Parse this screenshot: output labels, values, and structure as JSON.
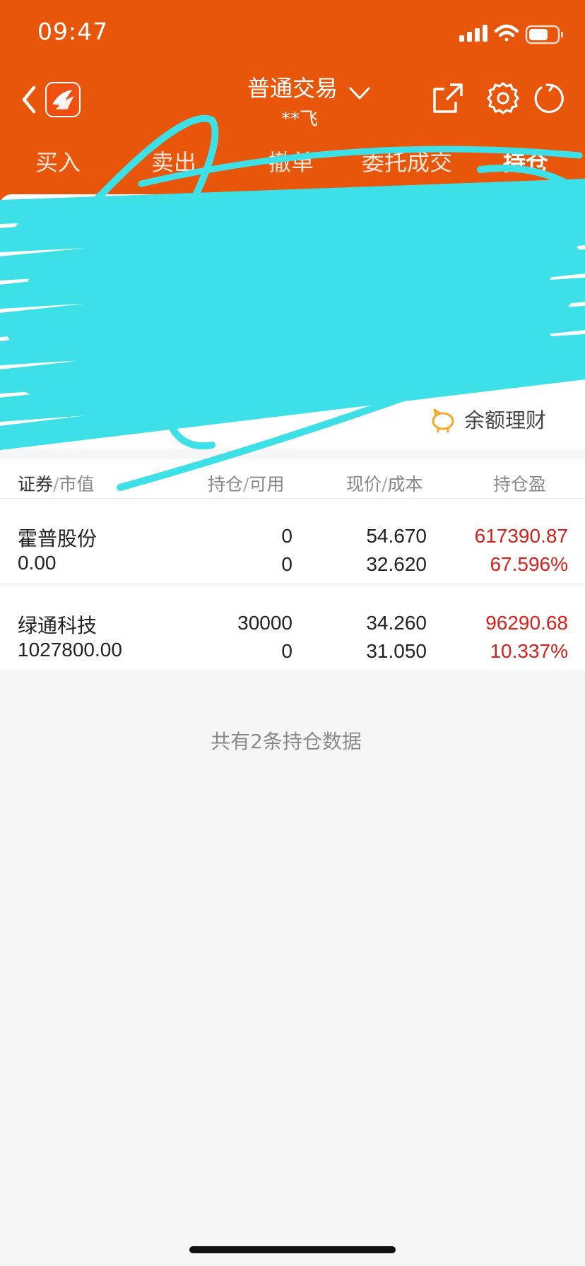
{
  "status_bar": {
    "time": "09:47"
  },
  "nav": {
    "title": "普通交易",
    "subtitle": "**飞",
    "icons": [
      "back-arrow-icon",
      "app-logo-icon",
      "chevron-down-icon",
      "share-icon",
      "gear-icon",
      "refresh-icon"
    ]
  },
  "tabs": [
    {
      "label": "买入",
      "active": false
    },
    {
      "label": "卖出",
      "active": false
    },
    {
      "label": "撤单",
      "active": false
    },
    {
      "label": "委托成交",
      "active": false
    },
    {
      "label": "持仓",
      "active": true
    }
  ],
  "shortcuts": {
    "balance_finance": "余额理财"
  },
  "table": {
    "headers": {
      "security": "证券",
      "market_value": "市值",
      "holding": "持仓",
      "available": "可用",
      "price": "现价",
      "cost": "成本",
      "profit": "持仓盈"
    },
    "separator": "/",
    "rows": [
      {
        "name": "霍普股份",
        "market_value": "0.00",
        "holding": "0",
        "available": "0",
        "price": "54.670",
        "cost": "32.620",
        "profit": "617390.87",
        "profit_pct": "67.596%"
      },
      {
        "name": "绿通科技",
        "market_value": "1027800.00",
        "holding": "30000",
        "available": "0",
        "price": "34.260",
        "cost": "31.050",
        "profit": "96290.68",
        "profit_pct": "10.337%"
      }
    ]
  },
  "footer": {
    "note": "共有2条持仓数据"
  },
  "colors": {
    "header": "#e8560b",
    "profit_red": "#d5201c",
    "scribble": "#3ee0e8",
    "background": "#f5f6f8"
  }
}
